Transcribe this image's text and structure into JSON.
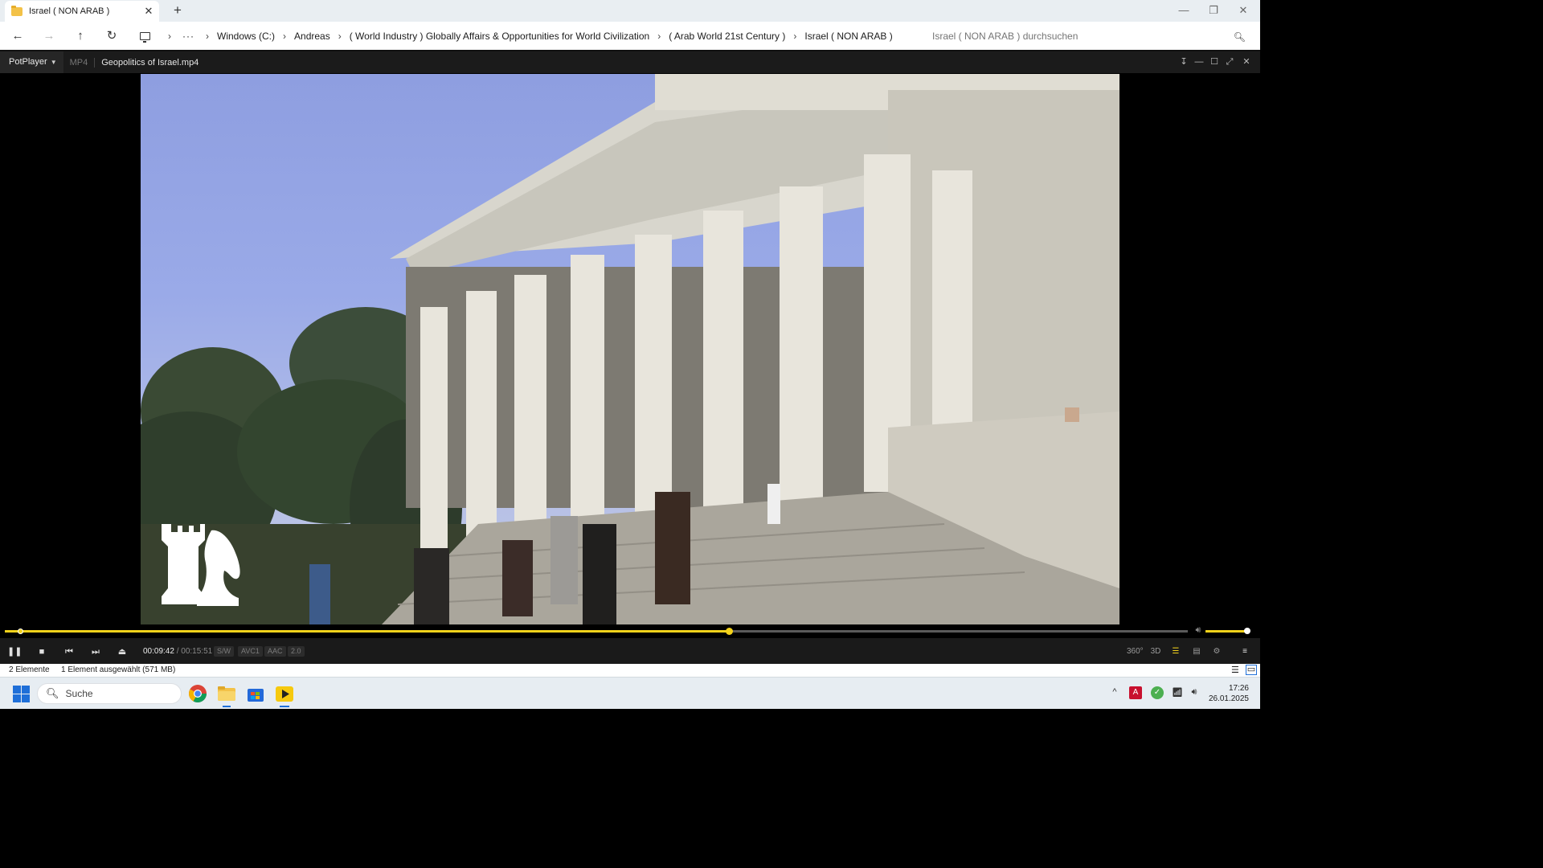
{
  "explorer": {
    "tab_title": "Israel ( NON ARAB )",
    "tab_close": "✕",
    "new_tab": "+",
    "window_controls": [
      "—",
      "❐",
      "✕"
    ],
    "nav": {
      "back": "←",
      "forward": "→",
      "up": "↑",
      "refresh": "↻"
    },
    "breadcrumb": [
      "Windows (C:)",
      "Andreas",
      "( World Industry ) Globally Affairs & Opportunities for World Civilization",
      "( Arab World 21st Century )",
      "Israel ( NON ARAB )"
    ],
    "breadcrumb_separator": "›",
    "breadcrumb_more": "···",
    "search_placeholder": "Israel ( NON ARAB ) durchsuchen",
    "status": {
      "items": "2 Elemente",
      "selected": "1 Element ausgewählt (571 MB)"
    }
  },
  "player": {
    "app_name": "PotPlayer",
    "format": "MP4",
    "file_name": "Geopolitics of Israel.mp4",
    "time_current": "00:09:42",
    "time_total": "00:15:51",
    "time_separator": "/",
    "badges": [
      "S/W",
      "AVC1",
      "AAC",
      "2.0"
    ],
    "right_buttons": [
      "360°",
      "3D"
    ],
    "progress_fraction": 0.612,
    "volume_fraction": 1.0,
    "accent_color": "#f3d21b"
  },
  "taskbar": {
    "search_placeholder": "Suche",
    "time": "17:26",
    "date": "26.01.2025",
    "tray_up": "^"
  }
}
